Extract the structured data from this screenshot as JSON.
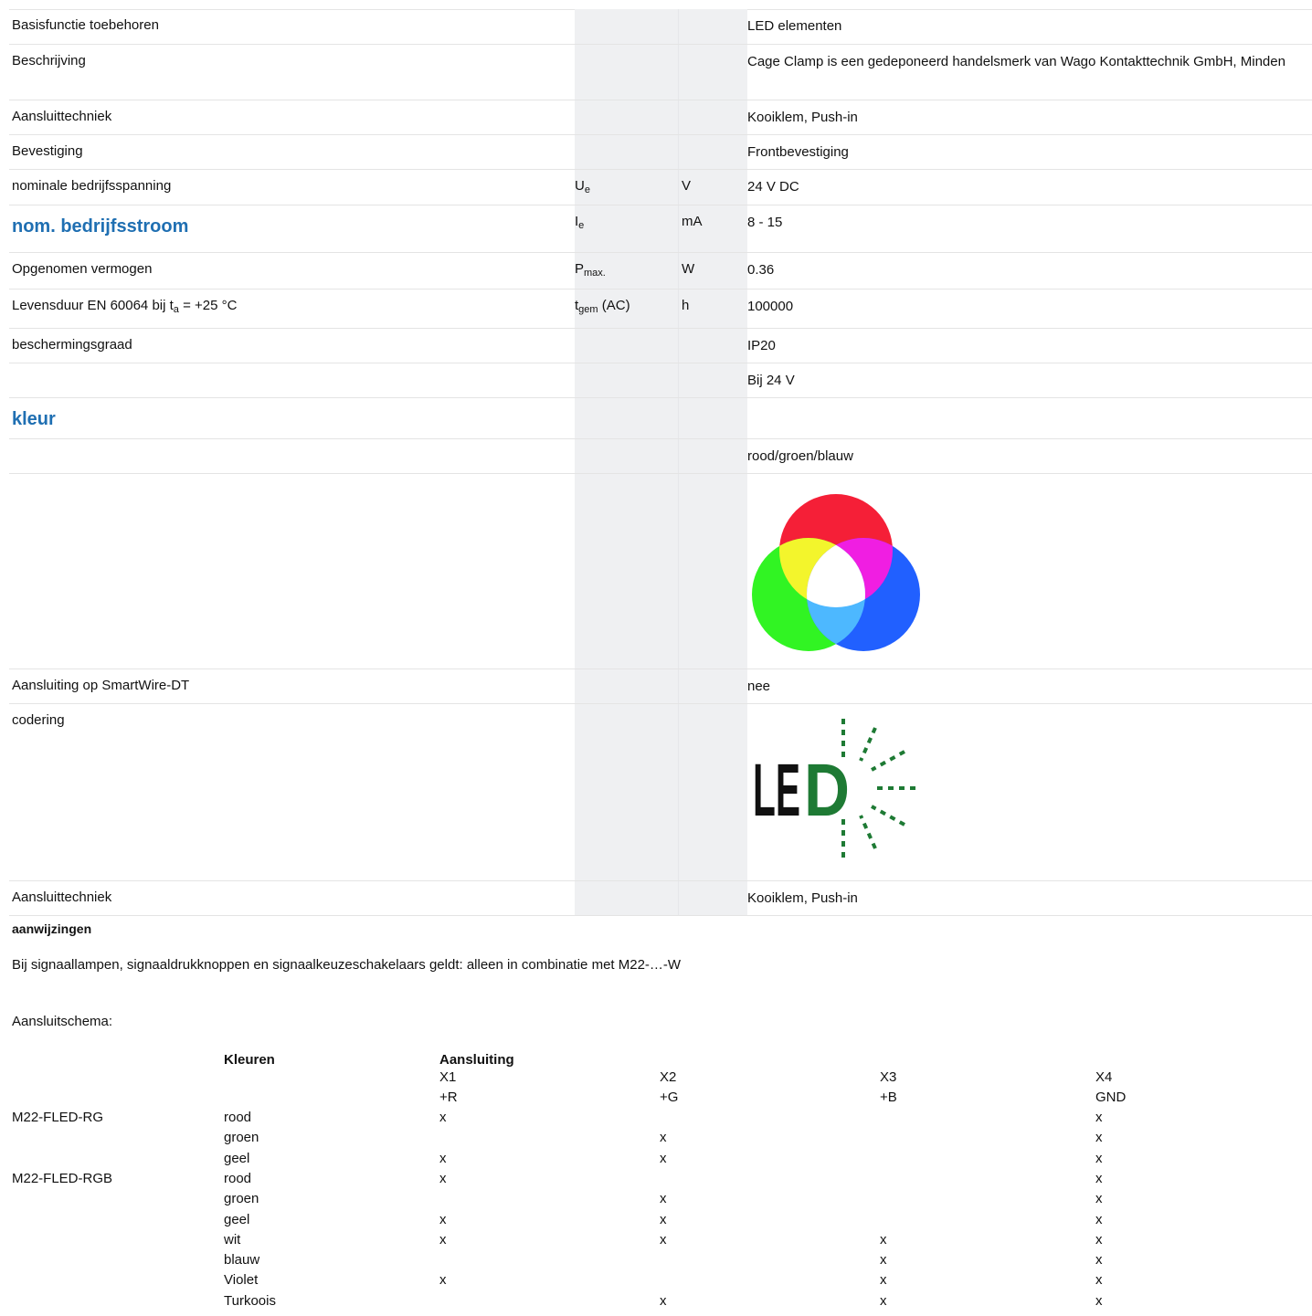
{
  "header_title": "",
  "specs": [
    {
      "label": "Basisfunctie toebehoren",
      "symbol": "",
      "unit": "",
      "value": "LED elementen"
    },
    {
      "label": "Beschrijving",
      "symbol": "",
      "unit": "",
      "value": "Cage Clamp is een gedeponeerd handelsmerk van Wago Kontakttechnik GmbH, Minden"
    },
    {
      "label": "Aansluittechniek",
      "symbol": "",
      "unit": "",
      "value": "Kooiklem, Push-in"
    },
    {
      "label": "Bevestiging",
      "symbol": "",
      "unit": "",
      "value": "Frontbevestiging"
    },
    {
      "label": "nominale bedrijfsspanning",
      "symbol": "U",
      "symbol_sub": "e",
      "unit": "V",
      "value": "24 V DC"
    },
    {
      "label": "nom. bedrijfsstroom",
      "symbol": "I",
      "symbol_sub": "e",
      "unit": "mA",
      "value": "8 - 15"
    },
    {
      "label": "Opgenomen vermogen",
      "symbol": "P",
      "symbol_sub": "max.",
      "unit": "W",
      "value": "0.36"
    },
    {
      "label_pre": "Levensduur EN 60064 bij t",
      "label_sub": "a",
      "label_post": " = +25 °C",
      "symbol": "t",
      "symbol_sub": "gem",
      "symbol_post": " (AC)",
      "unit": "h",
      "value": "100000"
    },
    {
      "label": "beschermingsgraad",
      "symbol": "",
      "unit": "",
      "value": "IP20"
    },
    {
      "label": "",
      "symbol": "",
      "unit": "",
      "value": "Bij 24 V"
    },
    {
      "label": "kleur",
      "symbol": "",
      "unit": "",
      "value": ""
    },
    {
      "label": "",
      "symbol": "",
      "unit": "",
      "value": "rood/groen/blauw"
    },
    {
      "label": "Aansluiting op SmartWire-DT",
      "symbol": "",
      "unit": "",
      "value": "nee"
    },
    {
      "label": "codering",
      "symbol": "",
      "unit": "",
      "value": ""
    },
    {
      "label": "Aansluittechniek",
      "symbol": "",
      "unit": "",
      "value": "Kooiklem, Push-in"
    }
  ],
  "led_logo_text": "LED",
  "notes": {
    "title": "aanwijzingen",
    "text": "Bij signaallampen, signaaldrukknoppen en signaalkeuzeschakelaars geldt: alleen in combinatie met M22-…-W",
    "schema_title": "Aansluitschema:"
  },
  "matrix": {
    "col_header_colors": "Kleuren",
    "col_header_conn": "Aansluiting",
    "terminals": [
      "X1",
      "X2",
      "X3",
      "X4"
    ],
    "signals": [
      "+R",
      "+G",
      "+B",
      "GND"
    ],
    "rows": [
      {
        "model": "M22-FLED-RG",
        "color": "rood",
        "x1": "x",
        "x2": "",
        "x3": "",
        "x4": "x"
      },
      {
        "model": "",
        "color": "groen",
        "x1": "",
        "x2": "x",
        "x3": "",
        "x4": "x"
      },
      {
        "model": "",
        "color": "geel",
        "x1": "x",
        "x2": "x",
        "x3": "",
        "x4": "x"
      },
      {
        "model": "M22-FLED-RGB",
        "color": "rood",
        "x1": "x",
        "x2": "",
        "x3": "",
        "x4": "x"
      },
      {
        "model": "",
        "color": "groen",
        "x1": "",
        "x2": "x",
        "x3": "",
        "x4": "x"
      },
      {
        "model": "",
        "color": "geel",
        "x1": "x",
        "x2": "x",
        "x3": "",
        "x4": "x"
      },
      {
        "model": "",
        "color": "wit",
        "x1": "x",
        "x2": "x",
        "x3": "x",
        "x4": "x"
      },
      {
        "model": "",
        "color": "blauw",
        "x1": "",
        "x2": "",
        "x3": "x",
        "x4": "x"
      },
      {
        "model": "",
        "color": "Violet",
        "x1": "x",
        "x2": "",
        "x3": "x",
        "x4": "x"
      },
      {
        "model": "",
        "color": "Turkoois",
        "x1": "",
        "x2": "x",
        "x3": "x",
        "x4": "x"
      }
    ]
  },
  "colors": {
    "accent": "#1f6fb2",
    "shaded_column": "#eff0f2",
    "led_green": "#1e7a34"
  }
}
